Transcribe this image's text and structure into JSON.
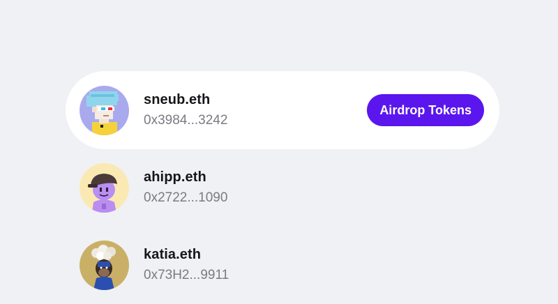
{
  "accounts": [
    {
      "name": "sneub.eth",
      "address": "0x3984...3242",
      "avatar_icon": "pixel-punk-avatar-icon",
      "avatar_bg": "#a9a9ee",
      "selected": true,
      "action_label": "Airdrop Tokens"
    },
    {
      "name": "ahipp.eth",
      "address": "0x2722...1090",
      "avatar_icon": "purple-character-avatar-icon",
      "avatar_bg": "#fbe9b3",
      "selected": false
    },
    {
      "name": "katia.eth",
      "address": "0x73H2...9911",
      "avatar_icon": "monkey-avatar-icon",
      "avatar_bg": "#c9b066",
      "selected": false
    }
  ],
  "colors": {
    "page_bg": "#f0f1f4",
    "accent": "#5b16ee",
    "name_text": "#16161a",
    "address_text": "#7a7a82"
  }
}
